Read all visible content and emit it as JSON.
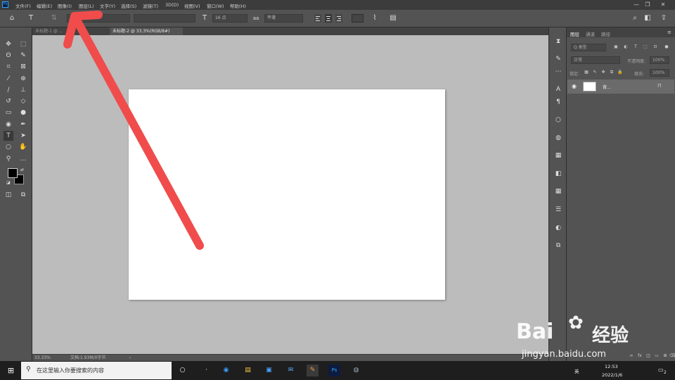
{
  "app": {
    "logo": "Ps"
  },
  "menu": [
    "文件(F)",
    "编辑(E)",
    "图像(I)",
    "图层(L)",
    "文字(Y)",
    "选择(S)",
    "滤镜(T)",
    "3D(D)",
    "视图(V)",
    "窗口(W)",
    "帮助(H)"
  ],
  "window_controls": {
    "minimize": "—",
    "restore": "❐",
    "close": "✕"
  },
  "options": {
    "font_size": "16 点",
    "anti_alias": "平滑",
    "font_family": "",
    "font_style": ""
  },
  "tabs": [
    {
      "label": "未标题-1 @ ..."
    },
    {
      "label": "未标题-2 @ 33.3%(RGB/8#)"
    }
  ],
  "status": {
    "zoom": "33.33%",
    "doc_info": "文档:1.93M/0字节"
  },
  "panels": {
    "tabs": [
      "图层",
      "通道",
      "路径"
    ],
    "search_placeholder": "Q 类型",
    "blend_mode": "正常",
    "opacity_label": "不透明度:",
    "opacity_value": "100%",
    "lock_label": "锁定:",
    "fill_label": "填充:",
    "fill_value": "100%",
    "layer_name": "背..."
  },
  "taskbar": {
    "search_placeholder": "在这里输入你要搜索的内容",
    "time": "12:53",
    "date": "2022/1/6",
    "ime": "英",
    "notifications": "2"
  },
  "watermark": {
    "brand": "Bai",
    "brand2": "经验",
    "url": "jingyan.baidu.com"
  },
  "colors": {
    "arrow": "#f04c4c",
    "foreground": "#000000",
    "background": "#ffffff",
    "ps_blue": "#31a8ff"
  },
  "icons": {
    "tools": [
      "move-icon",
      "marquee-icon",
      "lasso-icon",
      "quick-select-icon",
      "crop-icon",
      "frame-icon",
      "eyedropper-icon",
      "healing-icon",
      "brush-icon",
      "stamp-icon",
      "history-brush-icon",
      "eraser-icon",
      "gradient-icon",
      "blur-icon",
      "dodge-icon",
      "pen-icon",
      "type-icon",
      "path-select-icon",
      "ellipse-icon",
      "hand-icon",
      "zoom-icon",
      "more-tools-icon"
    ]
  }
}
